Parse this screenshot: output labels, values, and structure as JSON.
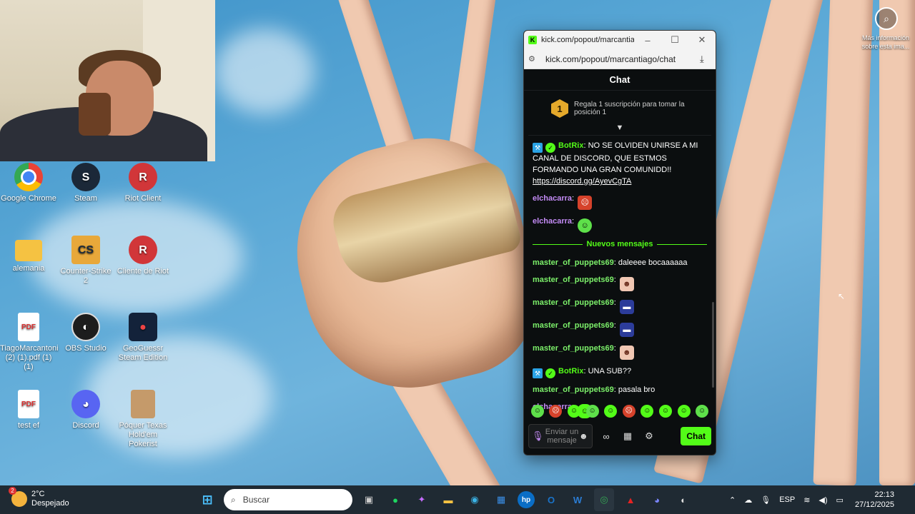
{
  "desktop_icons": [
    {
      "name": "google-chrome",
      "label": "Google Chrome",
      "glyph": ""
    },
    {
      "name": "steam",
      "label": "Steam",
      "glyph": "S"
    },
    {
      "name": "riot-client",
      "label": "Riot Client",
      "glyph": "R"
    },
    {
      "name": "alemania",
      "label": "alemania",
      "glyph": ""
    },
    {
      "name": "counter-strike-2",
      "label": "Counter-Strike 2",
      "glyph": "CS"
    },
    {
      "name": "cliente-de-riot",
      "label": "Cliente de Riot",
      "glyph": "R"
    },
    {
      "name": "tiago-pdf",
      "label": "TiagoMarcantoni (2) (1).pdf (1) (1)",
      "glyph": "PDF"
    },
    {
      "name": "obs-studio",
      "label": "OBS Studio",
      "glyph": "◐"
    },
    {
      "name": "geoguessr",
      "label": "GeoGuessr Steam Edition",
      "glyph": "●"
    },
    {
      "name": "test-ef",
      "label": "test ef",
      "glyph": "PDF"
    },
    {
      "name": "discord",
      "label": "Discord",
      "glyph": "◕"
    },
    {
      "name": "poquer",
      "label": "Póquer Texas Hold'em Pokerist",
      "glyph": ""
    }
  ],
  "lens": {
    "glyph": "⌕",
    "text": "Más información sobre esta ima..."
  },
  "popup": {
    "window_title": "kick.com/popout/marcantia...",
    "url": "kick.com/popout/marcantiago/chat",
    "favicon": "K",
    "chat_header": "Chat",
    "sub_banner": {
      "rank": "1",
      "text": "Regala 1 suscripción para tomar la posición 1"
    },
    "new_messages_label": "Nuevos mensajes",
    "messages": [
      {
        "user": "BotRix",
        "text": "NO SE OLVIDEN UNIRSE A MI CANAL DE DISCORD, QUE ESTMOS FORMANDO UNA GRAN COMUNIDD!!",
        "link": "https://discord.gg/AyevCgTA"
      },
      {
        "user": "elchacarra"
      },
      {
        "user": "elchacarra"
      },
      {
        "user": "master_of_puppets69",
        "text": "daleeee bocaaaaaa"
      },
      {
        "user": "master_of_puppets69"
      },
      {
        "user": "master_of_puppets69"
      },
      {
        "user": "master_of_puppets69"
      },
      {
        "user": "master_of_puppets69"
      },
      {
        "user": "BotRix",
        "text": "UNA SUB??"
      },
      {
        "user": "master_of_puppets69",
        "text": "pasala bro"
      },
      {
        "user": "elchacarra"
      }
    ],
    "input_placeholder": "Enviar un mensaje",
    "send_label": "Chat"
  },
  "taskbar": {
    "weather_temp": "2°C",
    "weather_desc": "Despejado",
    "weather_badge": "2",
    "search_placeholder": "Buscar",
    "language": "ESP",
    "time": "22:13",
    "date": "27/12/2025"
  }
}
